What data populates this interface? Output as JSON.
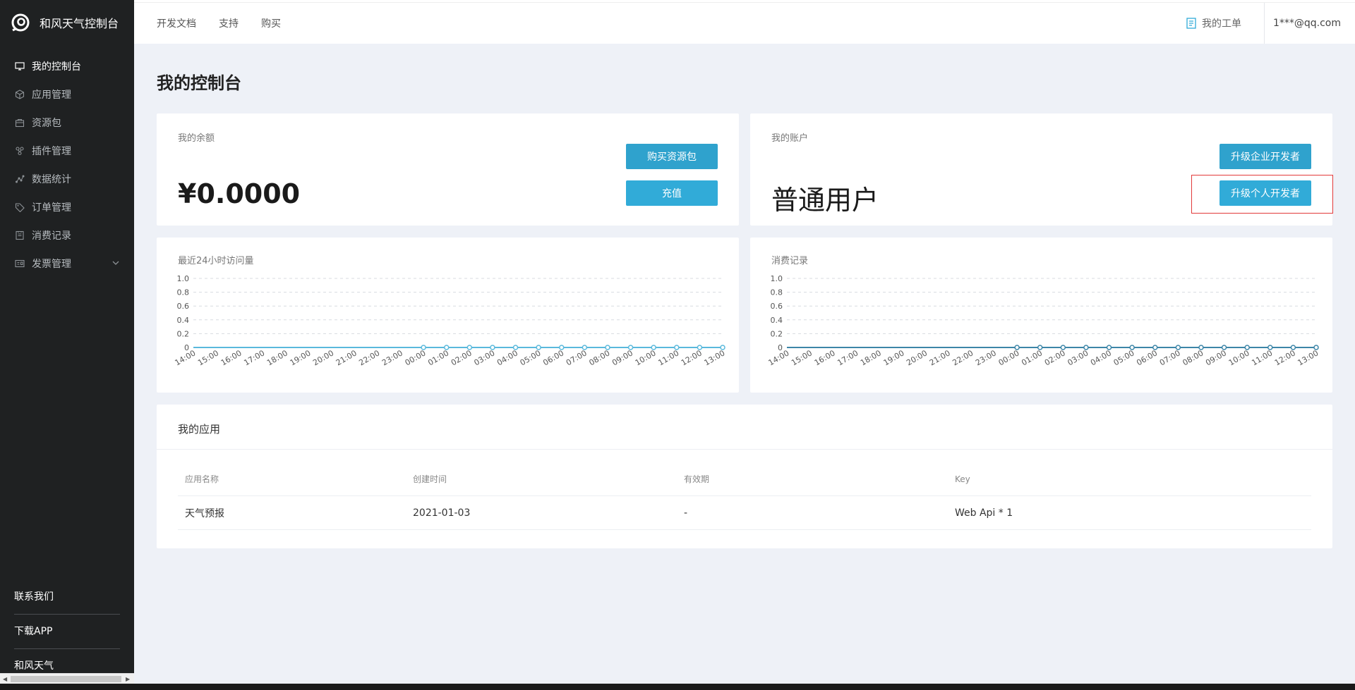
{
  "brand": {
    "name": "和风天气控制台"
  },
  "sidebar": {
    "items": [
      {
        "label": "我的控制台",
        "icon": "monitor-icon",
        "active": true
      },
      {
        "label": "应用管理",
        "icon": "cube-icon",
        "active": false
      },
      {
        "label": "资源包",
        "icon": "bag-icon",
        "active": false
      },
      {
        "label": "插件管理",
        "icon": "plugin-icon",
        "active": false
      },
      {
        "label": "数据统计",
        "icon": "stats-icon",
        "active": false
      },
      {
        "label": "订单管理",
        "icon": "tag-icon",
        "active": false
      },
      {
        "label": "消费记录",
        "icon": "receipt-icon",
        "active": false
      },
      {
        "label": "发票管理",
        "icon": "invoice-icon",
        "active": false
      }
    ],
    "footer": [
      {
        "label": "联系我们"
      },
      {
        "label": "下载APP"
      },
      {
        "label": "和风天气"
      }
    ]
  },
  "topbar": {
    "links": [
      "开发文档",
      "支持",
      "购买"
    ],
    "ticket_label": "我的工单",
    "account": "1***@qq.com"
  },
  "page": {
    "title": "我的控制台"
  },
  "balance_card": {
    "label": "我的余额",
    "amount": "¥0.0000",
    "buy_button": "购买资源包",
    "recharge_button": "充值"
  },
  "account_card": {
    "label": "我的账户",
    "type": "普通用户",
    "enterprise_button": "升级企业开发者",
    "personal_button": "升级个人开发者"
  },
  "chart_data": [
    {
      "type": "line",
      "title": "最近24小时访问量",
      "x": [
        "14:00",
        "15:00",
        "16:00",
        "17:00",
        "18:00",
        "19:00",
        "20:00",
        "21:00",
        "22:00",
        "23:00",
        "00:00",
        "01:00",
        "02:00",
        "03:00",
        "04:00",
        "05:00",
        "06:00",
        "07:00",
        "08:00",
        "09:00",
        "10:00",
        "11:00",
        "12:00",
        "13:00"
      ],
      "series": [
        {
          "values": [
            0,
            0,
            0,
            0,
            0,
            0,
            0,
            0,
            0,
            0,
            0,
            0,
            0,
            0,
            0,
            0,
            0,
            0,
            0,
            0,
            0,
            0,
            0,
            0
          ],
          "color": "#5ab9dc"
        }
      ],
      "yticks": [
        "0",
        "0.2",
        "0.4",
        "0.6",
        "0.8",
        "1.0"
      ],
      "ylim": [
        0,
        1
      ],
      "markers_from_index": 10,
      "grid": true
    },
    {
      "type": "line",
      "title": "消费记录",
      "x": [
        "14:00",
        "15:00",
        "16:00",
        "17:00",
        "18:00",
        "19:00",
        "20:00",
        "21:00",
        "22:00",
        "23:00",
        "00:00",
        "01:00",
        "02:00",
        "03:00",
        "04:00",
        "05:00",
        "06:00",
        "07:00",
        "08:00",
        "09:00",
        "10:00",
        "11:00",
        "12:00",
        "13:00"
      ],
      "series": [
        {
          "values": [
            0,
            0,
            0,
            0,
            0,
            0,
            0,
            0,
            0,
            0,
            0,
            0,
            0,
            0,
            0,
            0,
            0,
            0,
            0,
            0,
            0,
            0,
            0,
            0
          ],
          "color": "#3d86a8"
        }
      ],
      "yticks": [
        "0",
        "0.2",
        "0.4",
        "0.6",
        "0.8",
        "1.0"
      ],
      "ylim": [
        0,
        1
      ],
      "markers_from_index": 10,
      "grid": true
    }
  ],
  "apps": {
    "title": "我的应用",
    "columns": [
      "应用名称",
      "创建时间",
      "有效期",
      "Key"
    ],
    "rows": [
      [
        "天气预报",
        "2021-01-03",
        "-",
        "Web Api * 1"
      ]
    ]
  }
}
